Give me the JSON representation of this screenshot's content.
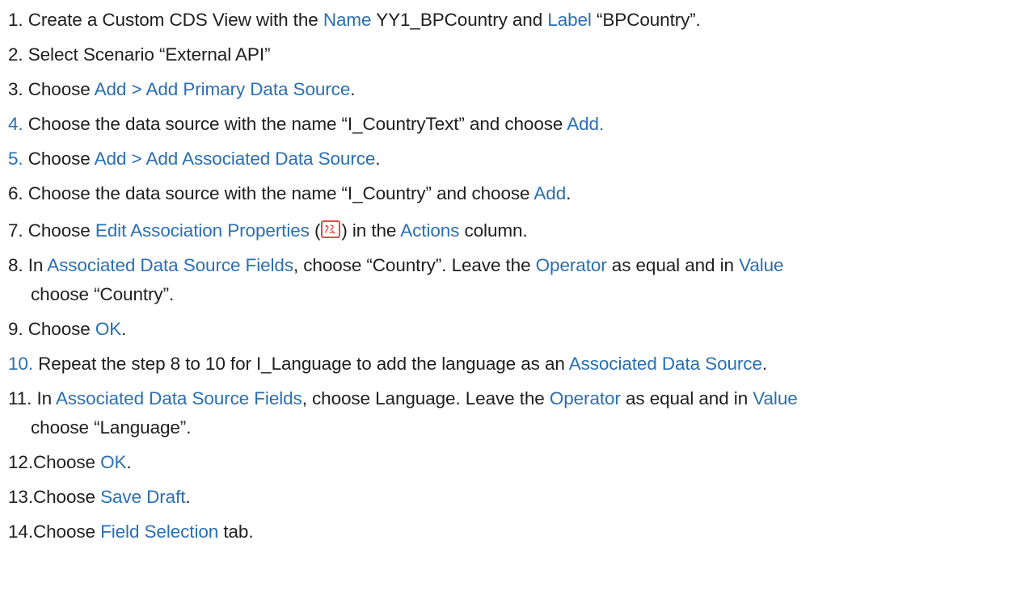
{
  "steps": [
    {
      "num": "1.",
      "parts": [
        "Create a Custom CDS View with the ",
        "Name",
        " YY1_BPCountry and ",
        "Label",
        " “BPCountry”."
      ]
    },
    {
      "num": "2.",
      "parts": [
        "Select Scenario “External API”"
      ]
    },
    {
      "num": "3.",
      "parts": [
        "Choose ",
        "Add > Add Primary Data Source",
        "."
      ]
    },
    {
      "num": "4.",
      "parts": [
        "Choose the data source with the name “I_CountryText” and choose ",
        "Add."
      ]
    },
    {
      "num": "5.",
      "parts": [
        "Choose ",
        "Add > Add Associated Data Source",
        "."
      ]
    },
    {
      "num": "6.",
      "parts": [
        "Choose the data source with the name “I_Country” and choose ",
        "Add",
        "."
      ]
    },
    {
      "num": "7.",
      "parts": [
        "Choose ",
        "Edit Association Properties",
        " (",
        ") in the ",
        "Actions",
        " column."
      ]
    },
    {
      "num": "8.",
      "parts": [
        "In ",
        "Associated Data Source Fields",
        ", choose “Country”. Leave the ",
        "Operator",
        " as equal and in ",
        "Value"
      ],
      "cont": "choose “Country”."
    },
    {
      "num": "9.",
      "parts": [
        "Choose ",
        "OK",
        "."
      ]
    },
    {
      "num": "10.",
      "parts": [
        "Repeat the step 8 to 10 for I_Language to add the language as an ",
        "Associated Data Source",
        "."
      ]
    },
    {
      "num": "11.",
      "parts": [
        "In ",
        "Associated Data Source Fields",
        ", choose Language. Leave the ",
        "Operator",
        " as equal and in ",
        "Value"
      ],
      "cont": "choose “Language”."
    },
    {
      "num": "12.",
      "parts": [
        "Choose ",
        "OK",
        "."
      ]
    },
    {
      "num": "13.",
      "parts": [
        "Choose ",
        "Save Draft",
        "."
      ]
    },
    {
      "num": "14.",
      "parts": [
        "Choose ",
        "Field Selection",
        " tab."
      ]
    }
  ],
  "icon": {
    "name": "edit-association-icon",
    "color": "#e04a4a"
  }
}
